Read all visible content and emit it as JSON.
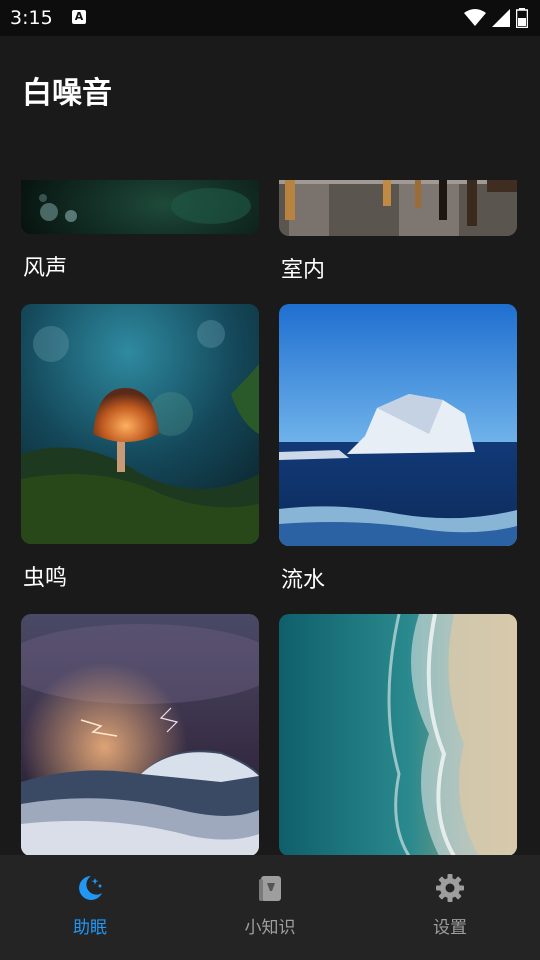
{
  "status_bar": {
    "time": "3:15",
    "notification_icon": "a-icon",
    "icons": [
      "wifi-icon",
      "signal-icon",
      "battery-icon"
    ]
  },
  "header": {
    "title": "白噪音"
  },
  "cards": [
    {
      "label": "风声",
      "image": "green-dark-bokeh"
    },
    {
      "label": "室内",
      "image": "restaurant-interior"
    },
    {
      "label": "虫鸣",
      "image": "glowing-mushroom"
    },
    {
      "label": "流水",
      "image": "iceberg-ocean"
    },
    {
      "label": "",
      "image": "stormy-sea-lightning"
    },
    {
      "label": "",
      "image": "beach-waves-aerial"
    }
  ],
  "nav": [
    {
      "label": "助眠",
      "icon": "moon-stars-icon",
      "active": true
    },
    {
      "label": "小知识",
      "icon": "book-icon",
      "active": false
    },
    {
      "label": "设置",
      "icon": "gear-icon",
      "active": false
    }
  ],
  "colors": {
    "accent": "#2196f3",
    "background": "#1a1a1a",
    "nav_background": "#242424",
    "inactive": "#9e9e9e"
  }
}
